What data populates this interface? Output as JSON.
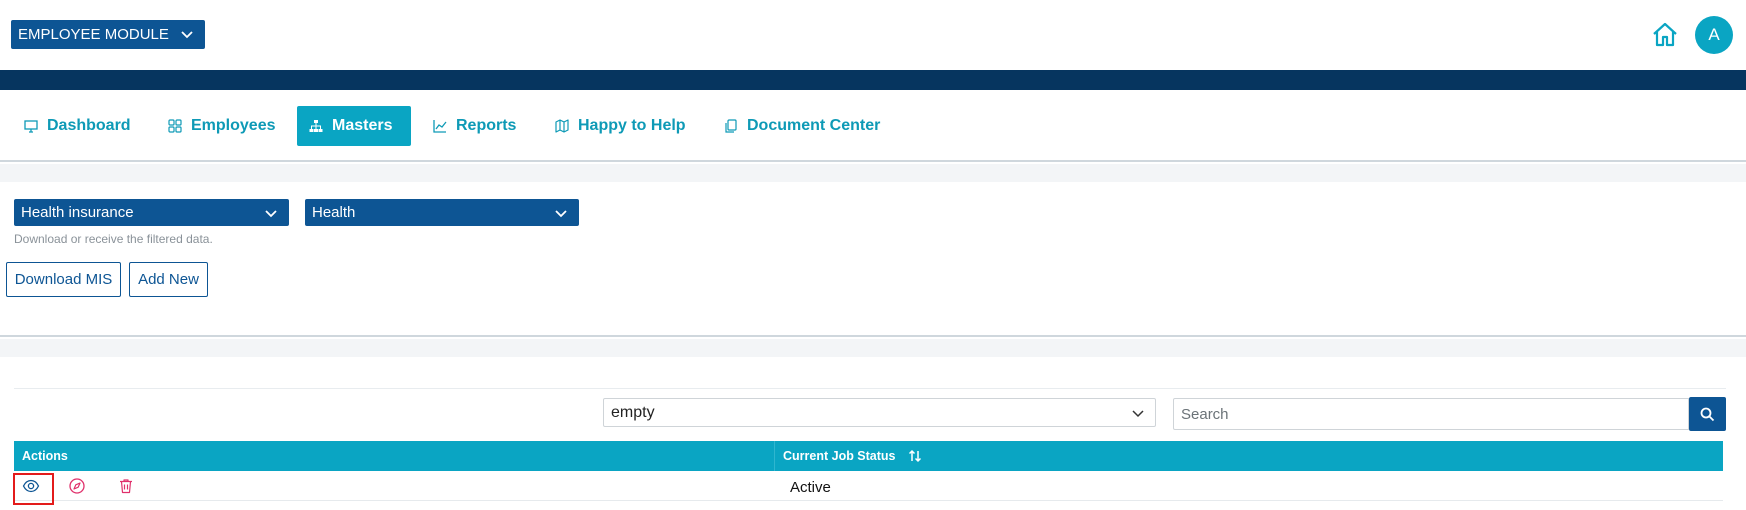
{
  "header": {
    "module_select": "EMPLOYEE MODULE",
    "avatar_letter": "A"
  },
  "nav": {
    "items": [
      {
        "label": "Dashboard",
        "icon": "monitor-icon"
      },
      {
        "label": "Employees",
        "icon": "grid-icon"
      },
      {
        "label": "Masters",
        "icon": "sitemap-icon",
        "active": true
      },
      {
        "label": "Reports",
        "icon": "line-chart-icon"
      },
      {
        "label": "Happy to Help",
        "icon": "map-icon"
      },
      {
        "label": "Document Center",
        "icon": "documents-icon"
      }
    ]
  },
  "filters": {
    "category_value": "Health insurance",
    "subcategory_value": "Health",
    "hint": "Download or receive the filtered data.",
    "download_label": "Download MIS",
    "add_new_label": "Add New"
  },
  "table": {
    "filter_value": "empty",
    "search_placeholder": "Search",
    "columns": [
      "Actions",
      "Current Job Status"
    ],
    "rows": [
      {
        "status": "Active"
      }
    ]
  },
  "colors": {
    "primary": "#0d5594",
    "accent": "#0aa5c3",
    "navy_band": "#06355f",
    "danger": "#e0306b"
  }
}
